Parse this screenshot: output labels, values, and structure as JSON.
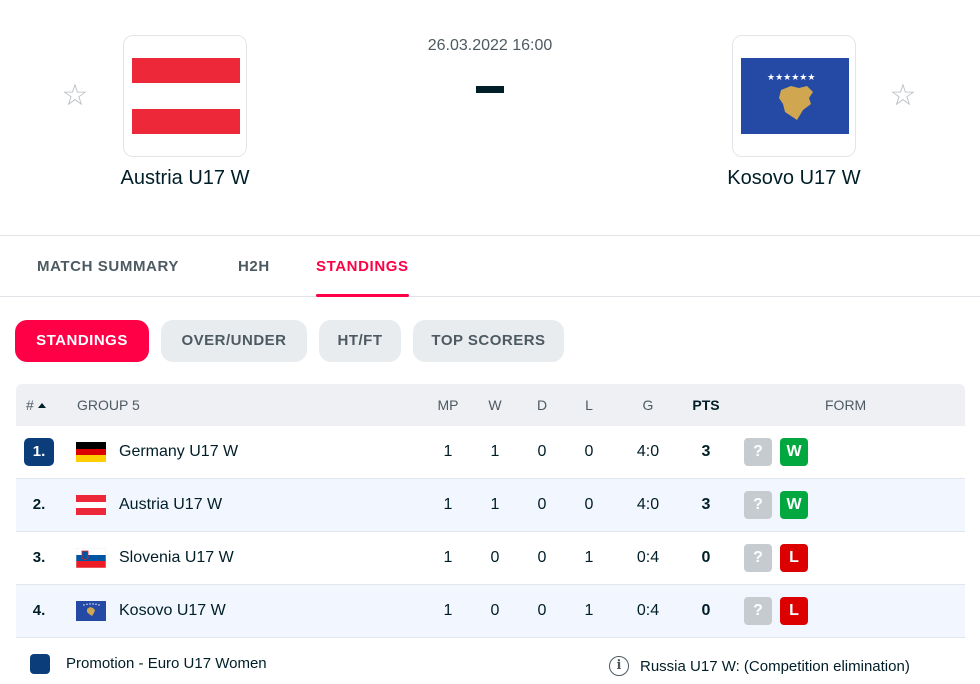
{
  "match": {
    "datetime": "26.03.2022 16:00",
    "score": "-",
    "home": {
      "name": "Austria U17 W",
      "flag": "austria-flag-icon"
    },
    "away": {
      "name": "Kosovo U17 W",
      "flag": "kosovo-flag-icon"
    },
    "favorite_icon": "star-outline-icon"
  },
  "main_tabs": [
    "MATCH SUMMARY",
    "H2H",
    "STANDINGS"
  ],
  "main_tabs_active": "STANDINGS",
  "sub_tabs": [
    "STANDINGS",
    "OVER/UNDER",
    "HT/FT",
    "TOP SCORERS"
  ],
  "sub_tabs_active": "STANDINGS",
  "table": {
    "headers": {
      "rank": "#",
      "group": "GROUP 5",
      "mp": "MP",
      "w": "W",
      "d": "D",
      "l": "L",
      "g": "G",
      "pts": "PTS",
      "form": "FORM"
    },
    "rows": [
      {
        "rank": "1.",
        "team": "Germany U17 W",
        "flag": "germany-flag-icon",
        "mp": "1",
        "w": "1",
        "d": "0",
        "l": "0",
        "g": "4:0",
        "pts": "3",
        "form": [
          "?",
          "W"
        ],
        "promotion": true
      },
      {
        "rank": "2.",
        "team": "Austria U17 W",
        "flag": "austria-flag-icon",
        "mp": "1",
        "w": "1",
        "d": "0",
        "l": "0",
        "g": "4:0",
        "pts": "3",
        "form": [
          "?",
          "W"
        ],
        "promotion": false
      },
      {
        "rank": "3.",
        "team": "Slovenia U17 W",
        "flag": "slovenia-flag-icon",
        "mp": "1",
        "w": "0",
        "d": "0",
        "l": "1",
        "g": "0:4",
        "pts": "0",
        "form": [
          "?",
          "L"
        ],
        "promotion": false
      },
      {
        "rank": "4.",
        "team": "Kosovo U17 W",
        "flag": "kosovo-flag-icon",
        "mp": "1",
        "w": "0",
        "d": "0",
        "l": "1",
        "g": "0:4",
        "pts": "0",
        "form": [
          "?",
          "L"
        ],
        "promotion": false
      }
    ]
  },
  "legend": {
    "promotion": "Promotion - Euro U17 Women",
    "info_icon": "info-icon",
    "info_glyph": "i",
    "note": "Russia U17 W: (Competition elimination)"
  },
  "colors": {
    "accent": "#ff0046",
    "promotion": "#0a3d7a",
    "win": "#00a83f",
    "loss": "#dc0000",
    "unknown": "#c6cbd0",
    "highlight_row": "#f1f6ff"
  }
}
